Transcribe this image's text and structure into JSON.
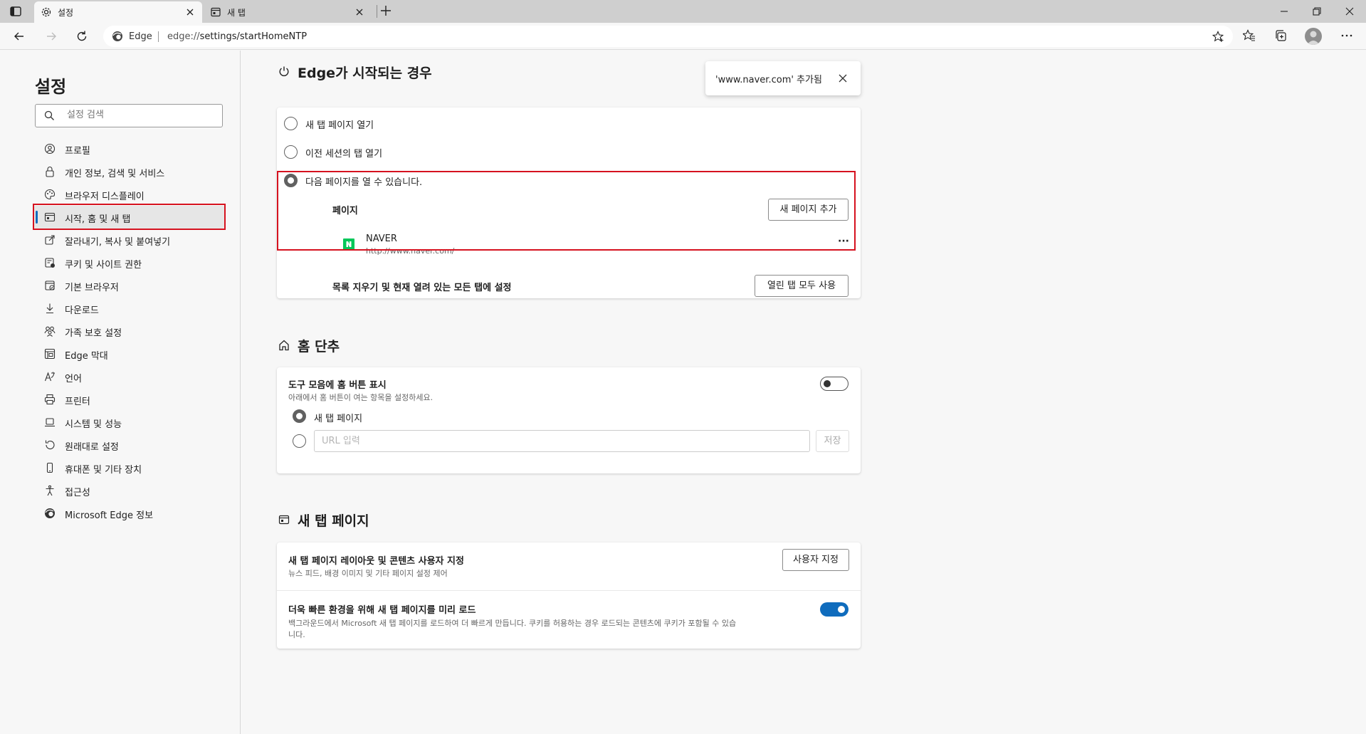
{
  "browser": {
    "tabs": [
      {
        "title": "설정",
        "active": true
      },
      {
        "title": "새 탭",
        "active": false
      }
    ],
    "site_label": "Edge",
    "url_scheme": "edge://",
    "url_path": "settings/startHomeNTP"
  },
  "sidebar": {
    "title": "설정",
    "search_placeholder": "설정 검색",
    "items": [
      {
        "label": "프로필",
        "icon": "profile-icon"
      },
      {
        "label": "개인 정보, 검색 및 서비스",
        "icon": "lock-icon"
      },
      {
        "label": "브라우저 디스플레이",
        "icon": "palette-icon"
      },
      {
        "label": "시작, 홈 및 새 탭",
        "icon": "home-tab-icon",
        "selected": true
      },
      {
        "label": "잘라내기, 복사 및 붙여넣기",
        "icon": "share-icon"
      },
      {
        "label": "쿠키 및 사이트 권한",
        "icon": "cookie-icon"
      },
      {
        "label": "기본 브라우저",
        "icon": "default-browser-icon"
      },
      {
        "label": "다운로드",
        "icon": "download-icon"
      },
      {
        "label": "가족 보호 설정",
        "icon": "family-icon"
      },
      {
        "label": "Edge 막대",
        "icon": "edge-bar-icon"
      },
      {
        "label": "언어",
        "icon": "language-icon"
      },
      {
        "label": "프린터",
        "icon": "printer-icon"
      },
      {
        "label": "시스템 및 성능",
        "icon": "laptop-icon"
      },
      {
        "label": "원래대로 설정",
        "icon": "reset-icon"
      },
      {
        "label": "휴대폰 및 기타 장치",
        "icon": "phone-icon"
      },
      {
        "label": "접근성",
        "icon": "accessibility-icon"
      },
      {
        "label": "Microsoft Edge 정보",
        "icon": "edge-logo-icon"
      }
    ]
  },
  "toast": {
    "text": "'www.naver.com' 추가됨"
  },
  "startup": {
    "title": "Edge가 시작되는 경우",
    "option_new_tab": "새 탭 페이지 열기",
    "option_previous": "이전 세션의 탭 열기",
    "option_pages": "다음 페이지를 열 수 있습니다.",
    "pages_label": "페이지",
    "add_page_button": "새 페이지 추가",
    "page_entry": {
      "name": "NAVER",
      "url": "http://www.naver.com/"
    },
    "more_button": "···",
    "use_all_tabs_label": "목록 지우기 및 현재 열려 있는 모든 탭에 설정",
    "use_all_tabs_button": "열린 탭 모두 사용"
  },
  "home": {
    "title": "홈 단추",
    "show_home_label": "도구 모음에 홈 버튼 표시",
    "show_home_desc": "아래에서 홈 버튼이 여는 항목을 설정하세요.",
    "show_home_enabled": false,
    "option_new_tab": "새 탭 페이지",
    "url_placeholder": "URL 입력",
    "save_button": "저장"
  },
  "newtab": {
    "title": "새 탭 페이지",
    "customize_label": "새 탭 페이지 레이아웃 및 콘텐츠 사용자 지정",
    "customize_desc": "뉴스 피드, 배경 이미지 및 기타 페이지 설정 제어",
    "customize_button": "사용자 지정",
    "preload_label": "더욱 빠른 환경을 위해 새 탭 페이지를 미리 로드",
    "preload_desc_line1": "백그라운드에서 Microsoft 새 탭 페이지를 로드하여 더 빠르게 만듭니다. 쿠키를 허용하는 경우 로드되는 콘텐츠에 쿠키가 포함될 수 있습",
    "preload_desc_line2": "니다.",
    "preload_enabled": true
  },
  "colors": {
    "accent": "#0f6cbd",
    "highlight_box": "#d6121f",
    "naver_green": "#03c75a"
  }
}
